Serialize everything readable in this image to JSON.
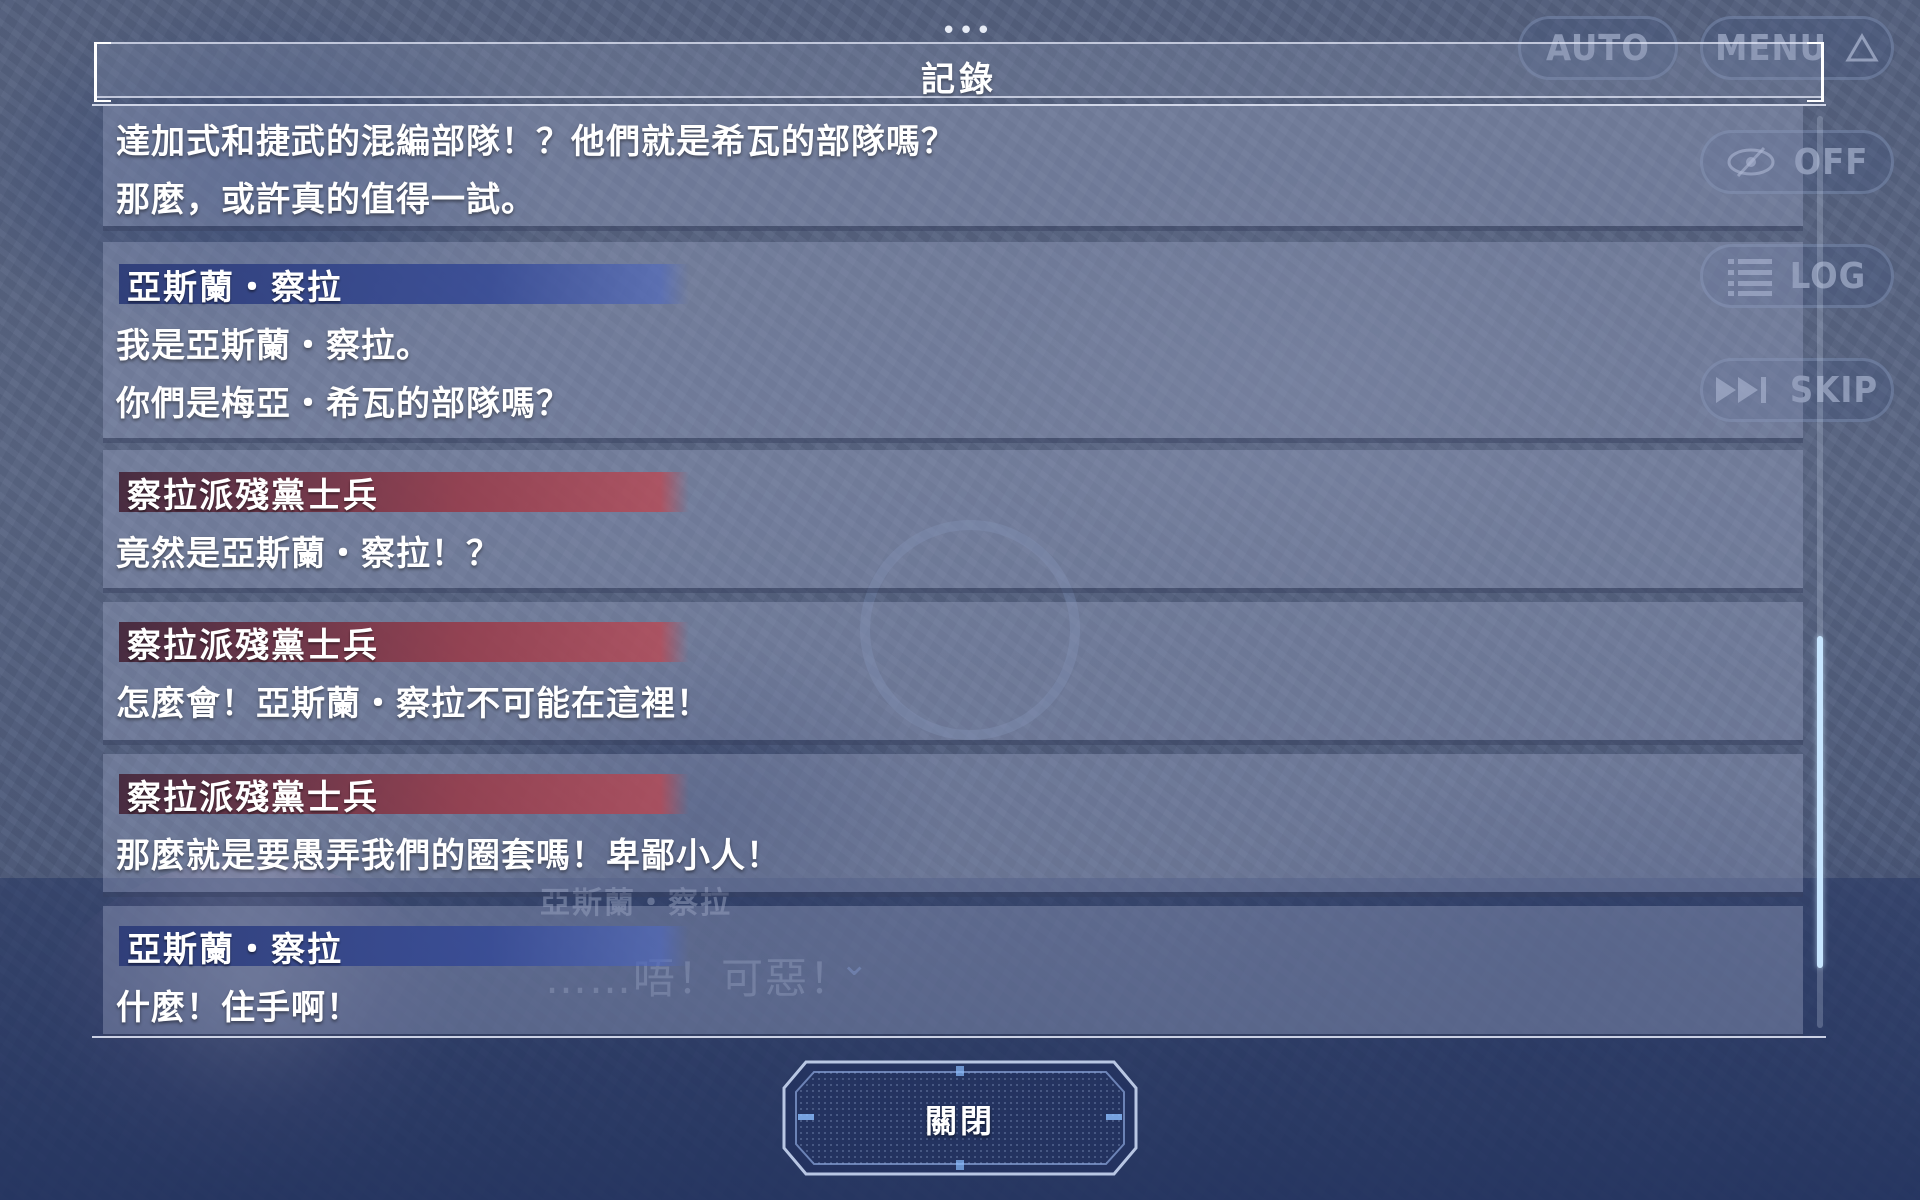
{
  "window": {
    "title": "記錄"
  },
  "hud": {
    "auto_label": "AUTO",
    "menu_label": "MENU",
    "menu_icon": "triangle-up-icon",
    "hide_label": "OFF",
    "hide_icon": "eye-slash-icon",
    "log_label": "LOG",
    "log_icon": "list-icon",
    "skip_label": "SKIP",
    "skip_icon": "fast-forward-icon"
  },
  "log": {
    "entries": [
      {
        "speaker": "",
        "speaker_color": "",
        "lines": [
          "達加式和捷武的混編部隊！？他們就是希瓦的部隊嗎？",
          "那麼，或許真的值得一試。"
        ]
      },
      {
        "speaker": "亞斯蘭・察拉",
        "speaker_color": "blue",
        "lines": [
          "我是亞斯蘭・察拉。",
          "你們是梅亞・希瓦的部隊嗎？"
        ]
      },
      {
        "speaker": "察拉派殘黨士兵",
        "speaker_color": "red",
        "lines": [
          "竟然是亞斯蘭・察拉！？"
        ]
      },
      {
        "speaker": "察拉派殘黨士兵",
        "speaker_color": "red",
        "lines": [
          "怎麼會！亞斯蘭・察拉不可能在這裡！"
        ]
      },
      {
        "speaker": "察拉派殘黨士兵",
        "speaker_color": "red",
        "lines": [
          "那麼就是要愚弄我們的圈套嗎！卑鄙小人！"
        ]
      },
      {
        "speaker": "亞斯蘭・察拉",
        "speaker_color": "blue",
        "lines": [
          "什麼！住手啊！"
        ]
      }
    ],
    "scroll_position": 0.57
  },
  "background_dialog": {
    "speaker": "亞斯蘭・察拉",
    "line": "……唔！可惡！"
  },
  "close_button": {
    "label": "關閉"
  },
  "colors": {
    "blue_nameplate": "#37488f",
    "red_nameplate": "#96404b",
    "scroll_thumb": "#c8e6ff"
  }
}
